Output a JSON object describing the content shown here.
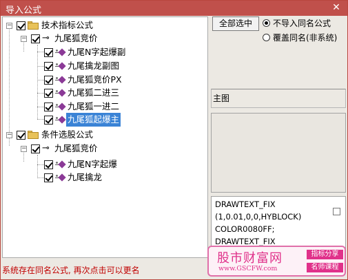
{
  "window": {
    "title": "导入公式",
    "close_glyph": "✕"
  },
  "tree": {
    "groups": [
      {
        "label": "技术指标公式",
        "sub": {
          "label": "九尾狐竞价",
          "leaves": [
            "九尾N字起爆副",
            "九尾擒龙副图",
            "九尾狐竞价PX",
            "九尾狐二进三",
            "九尾狐一进二",
            "九尾狐起爆主"
          ]
        }
      },
      {
        "label": "条件选股公式",
        "sub": {
          "label": "九尾狐竞价",
          "leaves": [
            "九尾N字起爆",
            "九尾擒龙"
          ]
        }
      }
    ],
    "selected_leaf": "九尾狐起爆主"
  },
  "right": {
    "select_all_label": "全部选中",
    "radio_skip_label": "不导入同名公式",
    "radio_overwrite_label": "覆盖同名(非系统)",
    "main_label": "主图",
    "code_lines": [
      "DRAWTEXT_FIX",
      "(1,0.01,0,0,HYBLOCK)",
      "COLOR0080FF;",
      "DRAWTEXT_FIX"
    ]
  },
  "status": "系统存在同名公式, 再次点击可以更名",
  "watermark": {
    "title": "股市财富网",
    "url": "www.GSCFW.com",
    "tag1": "指标分享",
    "tag2": "名师课程"
  },
  "colors": {
    "titlebar": "#c0504b",
    "selection": "#3a83d6",
    "status_text": "#c00000",
    "leaf_icon": "#8b3a97"
  }
}
